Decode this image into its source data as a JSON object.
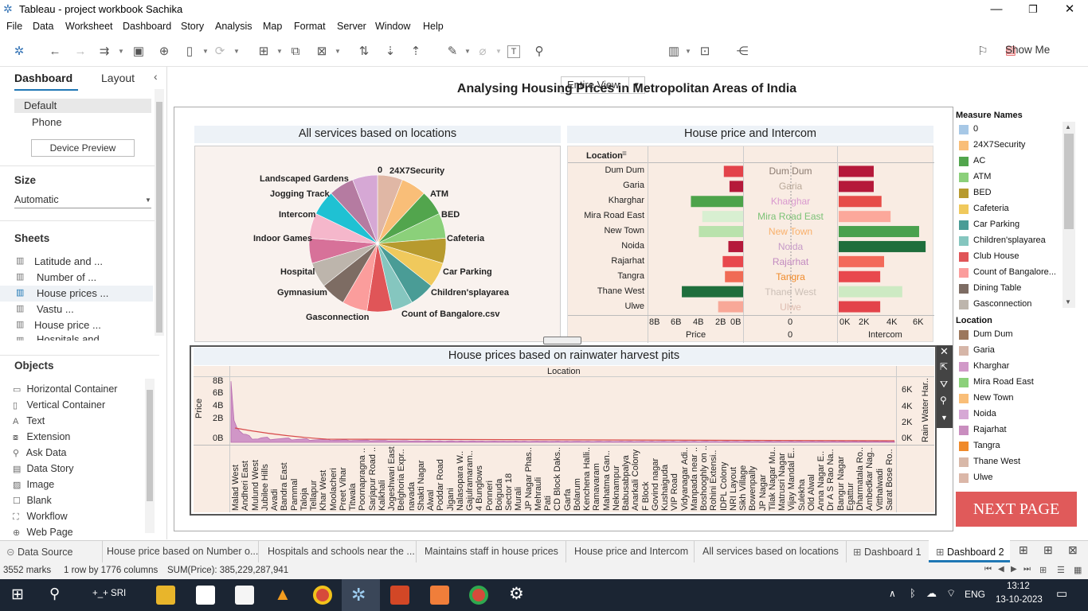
{
  "window": {
    "title": "Tableau - project workbook Sachika"
  },
  "menu": [
    "File",
    "Data",
    "Worksheet",
    "Dashboard",
    "Story",
    "Analysis",
    "Map",
    "Format",
    "Server",
    "Window",
    "Help"
  ],
  "toolbar": {
    "fit": "Entire View",
    "show_me": "Show Me"
  },
  "left_panel": {
    "tab_dashboard": "Dashboard",
    "tab_layout": "Layout",
    "devices": [
      "Default",
      "Phone"
    ],
    "device_preview": "Device Preview",
    "size_title": "Size",
    "size_value": "Automatic",
    "sheets_title": "Sheets",
    "sheets": [
      "Latitude and ...",
      "Number of ...",
      "House prices ...",
      "Vastu ...",
      "House price ...",
      "Hospitals and"
    ],
    "objects_title": "Objects",
    "objects": [
      "Horizontal Container",
      "Vertical Container",
      "Text",
      "Extension",
      "Ask Data",
      "Data Story",
      "Image",
      "Blank",
      "Workflow",
      "Web Page"
    ]
  },
  "dashboard": {
    "title": "Analysing Housing Prices in Metropolitan Areas of India",
    "pie_title": "All services based on locations",
    "pie_labels": [
      "0",
      "24X7Security",
      "ATM",
      "BED",
      "Cafeteria",
      "Car Parking",
      "Children'splayarea",
      "Count of Bangalore.csv",
      "Gasconnection",
      "Gymnasium",
      "Hospital",
      "Indoor Games",
      "Intercom",
      "Jogging Track",
      "Landscaped Gardens"
    ],
    "bar_title": "House price and Intercom",
    "bar_header": "Location",
    "bar_price_axis": "Price",
    "bar_mid_axis": "0",
    "bar_intercom_axis": "Intercom",
    "price_ticks": [
      "8B",
      "6B",
      "4B",
      "2B",
      "0B"
    ],
    "mid_tick": "0",
    "intercom_ticks": [
      "0K",
      "2K",
      "4K",
      "6K"
    ],
    "line_title": "House prices based on rainwater harvest pits",
    "line_header": "Location",
    "line_y_left": "Price",
    "line_y_right": "Rain Water Har..",
    "line_left_ticks": [
      "8B",
      "6B",
      "4B",
      "2B",
      "0B"
    ],
    "line_right_ticks": [
      "6K",
      "4K",
      "2K",
      "0K"
    ],
    "line_locations": [
      "Malad West",
      "Andheri East",
      "Mulund West",
      "Jubilee Hills",
      "Avadi",
      "Bandra East",
      "Pammal",
      "Taloja",
      "Tellapur",
      "Khar West",
      "Moolacheri",
      "Preet Vihar",
      "Titwala",
      "Poornapragna ..",
      "Sarjapur Road ..",
      "Kalkhali",
      "Jogeshwari East",
      "Belghoria Expr..",
      "navada",
      "Shakti Nagar",
      "Alwal",
      "Poddar Road",
      "Jigani",
      "Nalasopara W..",
      "Gajulramaram..",
      "4 Bunglows",
      "Ponneri",
      "Boiguda",
      "Sector 18",
      "Murali",
      "JP Nagar Phas..",
      "Mehrauli",
      "Pati",
      "CD Block Daks..",
      "Garfa",
      "Bolarum",
      "Kenchena Halli..",
      "Ramavaram",
      "Mahatma Gan..",
      "Neknampur",
      "Babusabpalya",
      "Anarkali Colony",
      "F Block",
      "Govind nagar",
      "Kushaiguda",
      "VIP Road",
      "Vidyanagar Adi..",
      "Manpada near ..",
      "Boshooghly on ..",
      "Rohini Extensi..",
      "IDPL Colony",
      "NRI Layout",
      "Sikh Village",
      "Bowenpally",
      "JP Nagar",
      "Tilak Nagar Mu..",
      "Matrusri Nagar",
      "Vijay Mandal E..",
      "Sulekha",
      "Old Alwal",
      "Anna Nagar E..",
      "Dr A S Rao Na..",
      "Bangur Nagar",
      "Egattur",
      "Dharmatala Ro..",
      "Ambedkar Nag..",
      "Vitthalwadi",
      "Sarat Bose Ro.."
    ]
  },
  "chart_data": [
    {
      "type": "pie",
      "title": "All services based on locations",
      "categories": [
        "0",
        "24X7Security",
        "ATM",
        "BED",
        "Cafeteria",
        "Car Parking",
        "Children'splayarea",
        "Club House",
        "Count of Bangalore.csv",
        "Dining Table",
        "Gasconnection",
        "Gymnasium",
        "Hospital",
        "Indoor Games",
        "Intercom",
        "Jogging Track",
        "Landscaped Gardens"
      ],
      "values": [
        6,
        6,
        6,
        6,
        6,
        6,
        6,
        5,
        6,
        6,
        6,
        6,
        6,
        6,
        6,
        6,
        6
      ],
      "colors": [
        "#e0b7a5",
        "#f9be78",
        "#52a54d",
        "#8bd07a",
        "#b79a2e",
        "#f0c95c",
        "#4a9c96",
        "#85c6bf",
        "#e05558",
        "#fb9d9c",
        "#7d6c63",
        "#bdb5ac",
        "#d77199",
        "#f5b7cb",
        "#1fc1d3",
        "#b57ba1",
        "#d6a8d5",
        "#9c775c"
      ]
    },
    {
      "type": "bar",
      "title": "House price and Intercom",
      "categories": [
        "Dum Dum",
        "Garia",
        "Kharghar",
        "Mira Road East",
        "New Town",
        "Noida",
        "Rajarhat",
        "Tangra",
        "Thane West",
        "Ulwe"
      ],
      "series": [
        {
          "name": "Price",
          "values": [
            1700000000.0,
            1200000000.0,
            4600000000.0,
            3600000000.0,
            3900000000.0,
            1300000000.0,
            1800000000.0,
            1600000000.0,
            5400000000.0,
            2200000000.0
          ]
        },
        {
          "name": "Intercom",
          "values": [
            2700,
            2700,
            3300,
            4000,
            6200,
            6700,
            3500,
            3200,
            4900,
            3200
          ]
        }
      ],
      "price_ylim": [
        0,
        8000000000.0
      ],
      "intercom_ylim": [
        0,
        7000
      ],
      "colors": [
        "#e3434a",
        "#b5193a",
        "#4da34a",
        "#d8efd1",
        "#b9e2ac",
        "#b5193a",
        "#e8484d",
        "#f06b55",
        "#1f6e3c",
        "#f8a898"
      ],
      "intercom_colors": [
        "#b5193a",
        "#b5193a",
        "#e64d48",
        "#fca89b",
        "#4aa14e",
        "#1f6e3c",
        "#f36a5a",
        "#e8484d",
        "#cdeac3",
        "#e3434a"
      ],
      "label_colors": [
        "#8a7a70",
        "#b8a898",
        "#d999cf",
        "#7bc276",
        "#f9b06b",
        "#c69ac8",
        "#c28ac0",
        "#f08a2a",
        "#cbbfb6",
        "#ddbcb0"
      ]
    },
    {
      "type": "area",
      "title": "House prices based on rainwater harvest pits",
      "ylabel": "Price",
      "y2label": "Rain Water Har..",
      "ylim": [
        0,
        8000000000.0
      ],
      "y2lim": [
        0,
        7000
      ],
      "x": [
        "Malad West",
        "Andheri East",
        "Mulund West",
        "Jubilee Hills",
        "Avadi",
        "Bandra East",
        "Pammal",
        "Taloja",
        "Tellapur",
        "Khar West"
      ],
      "values": [
        7500000000.0,
        2600000000.0,
        1600000000.0,
        1100000000.0,
        700000000.0,
        600000000.0,
        400000000.0,
        350000000.0,
        300000000.0,
        250000000.0
      ]
    }
  ],
  "legend": {
    "measure_title": "Measure Names",
    "measures": [
      {
        "label": "0",
        "color": "#a7c8e6"
      },
      {
        "label": "24X7Security",
        "color": "#f9be78"
      },
      {
        "label": "AC",
        "color": "#52a54d"
      },
      {
        "label": "ATM",
        "color": "#8bd07a"
      },
      {
        "label": "BED",
        "color": "#b79a2e"
      },
      {
        "label": "Cafeteria",
        "color": "#f0c95c"
      },
      {
        "label": "Car Parking",
        "color": "#4a9c96"
      },
      {
        "label": "Children'splayarea",
        "color": "#85c6bf"
      },
      {
        "label": "Club House",
        "color": "#e05558"
      },
      {
        "label": "Count of Bangalore...",
        "color": "#fb9d9c"
      },
      {
        "label": "Dining Table",
        "color": "#7d6c63"
      },
      {
        "label": "Gasconnection",
        "color": "#bdb5ac"
      }
    ],
    "location_title": "Location",
    "locations": [
      {
        "label": "Dum Dum",
        "color": "#9c775c"
      },
      {
        "label": "Garia",
        "color": "#d6b6a8"
      },
      {
        "label": "Kharghar",
        "color": "#d199c8"
      },
      {
        "label": "Mira Road East",
        "color": "#8bd07a"
      },
      {
        "label": "New Town",
        "color": "#f9be78"
      },
      {
        "label": "Noida",
        "color": "#d6a8d5"
      },
      {
        "label": "Rajarhat",
        "color": "#c98dbf"
      },
      {
        "label": "Tangra",
        "color": "#f08a2a"
      },
      {
        "label": "Thane West",
        "color": "#d8b8a8"
      },
      {
        "label": "Ulwe",
        "color": "#dbb7a8"
      }
    ],
    "next_page": "NEXT PAGE"
  },
  "tabs": [
    "Data Source",
    "House price based on Number o...",
    "Hospitals and schools near the ...",
    "Maintains staff in house prices",
    "House price and Intercom",
    "All services based on locations",
    "Dashboard 1",
    "Dashboard 2"
  ],
  "status": {
    "marks": "3552 marks",
    "rows": "1 row by 1776 columns",
    "sum": "SUM(Price): 385,229,287,941"
  },
  "taskbar": {
    "user": "+_+ SRI",
    "lang": "ENG",
    "time": "13:12",
    "date": "13-10-2023"
  }
}
